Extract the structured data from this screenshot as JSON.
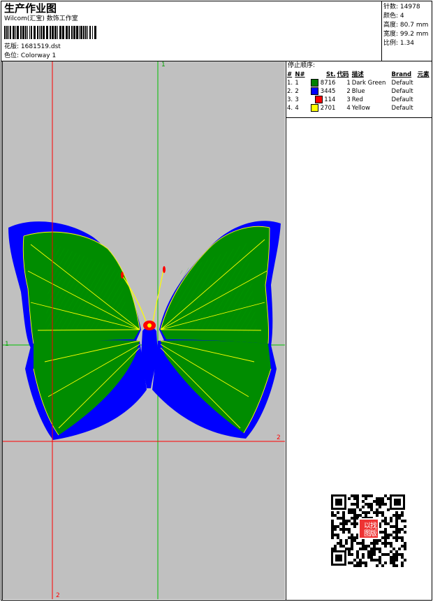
{
  "header": {
    "title": "生产作业图",
    "subtitle": "Wilcom(汇宝) 数饰工作室",
    "design_label": "花版:",
    "design_file": "1681519.dst",
    "color_label": "色位:",
    "colorway": "Colorway 1"
  },
  "stats": [
    {
      "label": "针数:",
      "value": "14978"
    },
    {
      "label": "颜色:",
      "value": "4"
    },
    {
      "label": "高度:",
      "value": "80.7 mm"
    },
    {
      "label": "宽度:",
      "value": "99.2 mm"
    },
    {
      "label": "比例:",
      "value": "1.34"
    }
  ],
  "stop_sequence": {
    "title": "停止顺序:",
    "headers": [
      "#",
      "N#",
      "St.",
      "代码",
      "描述",
      "Brand",
      "元素"
    ],
    "rows": [
      {
        "num": "1.",
        "n": "1",
        "color": "#008000",
        "stitches": "8716",
        "code": "1",
        "desc": "Dark Green",
        "brand": "Default"
      },
      {
        "num": "2.",
        "n": "2",
        "color": "#0000ff",
        "stitches": "3445",
        "code": "2",
        "desc": "Blue",
        "brand": "Default"
      },
      {
        "num": "3.",
        "n": "3",
        "color": "#ff0000",
        "stitches": "114",
        "code": "3",
        "desc": "Red",
        "brand": "Default"
      },
      {
        "num": "4.",
        "n": "4",
        "color": "#ffff00",
        "stitches": "2701",
        "code": "4",
        "desc": "Yellow",
        "brand": "Default"
      }
    ]
  },
  "guides": {
    "green_top": "1",
    "green_left": "1",
    "red_right": "2",
    "red_bottom": "2"
  },
  "qr_stamp": {
    "text": [
      "以",
      "图",
      "找",
      "版"
    ],
    "color": "#ff0000"
  },
  "colors": {
    "canvas_bg": "#c0c0c0",
    "guide_green": "#00c000",
    "guide_red": "#ff0000"
  }
}
